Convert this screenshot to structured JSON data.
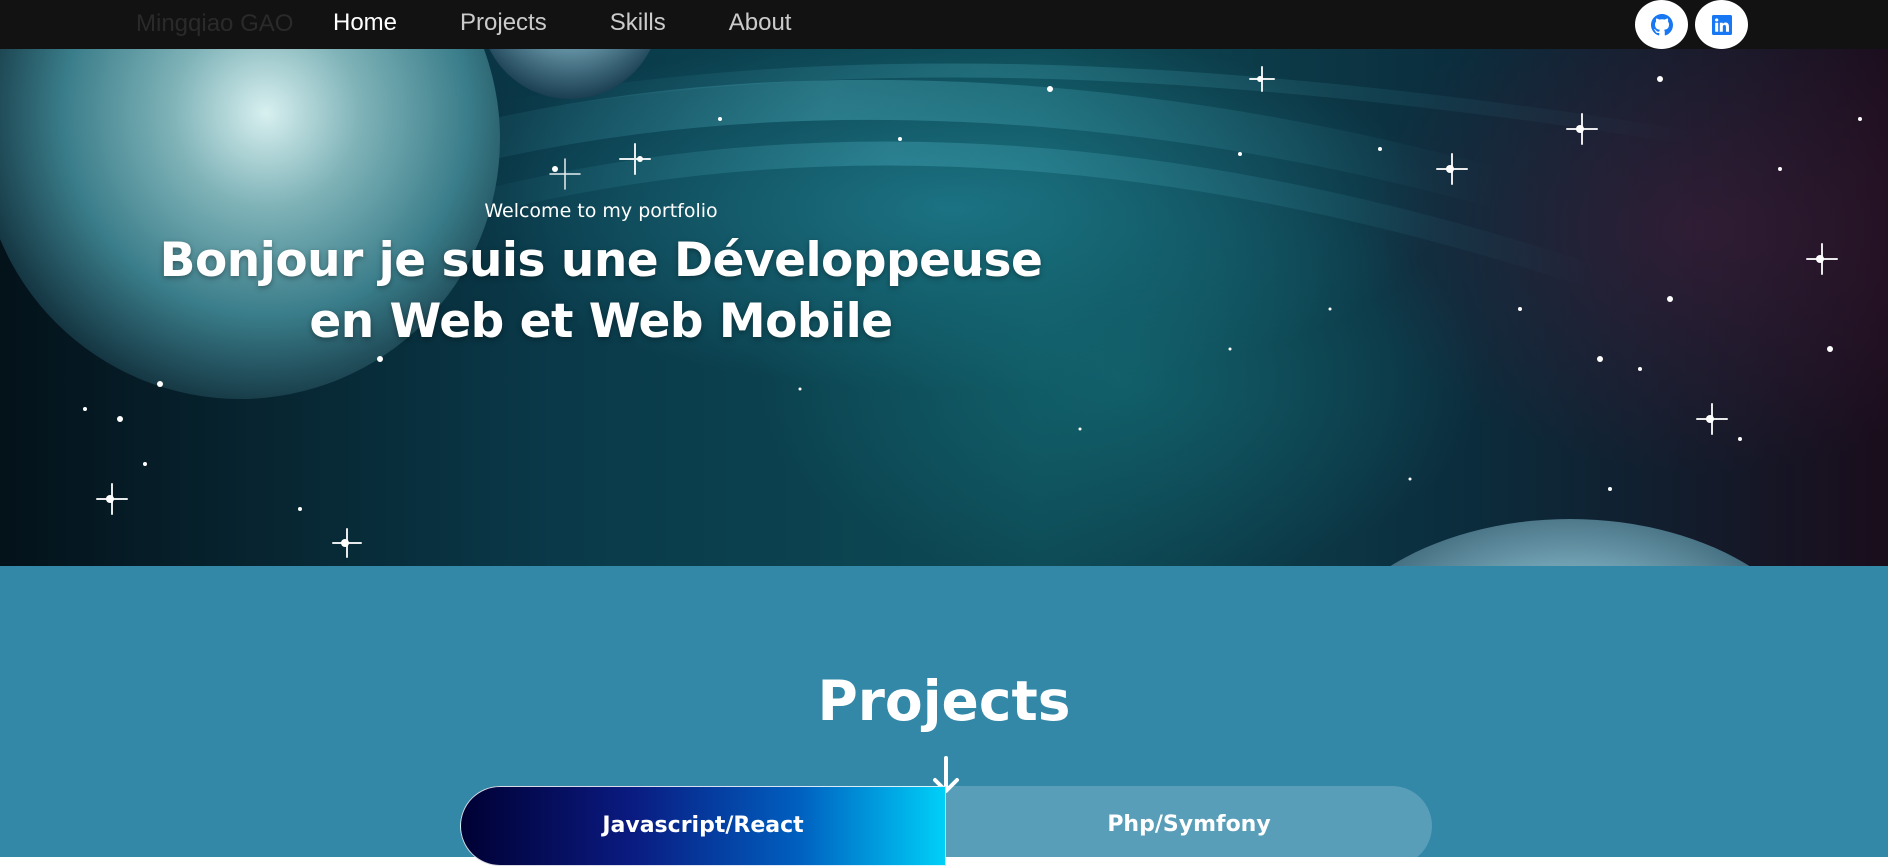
{
  "navbar": {
    "brand": "Mingqiao GAO",
    "links": [
      {
        "label": "Home",
        "active": true
      },
      {
        "label": "Projects",
        "active": false
      },
      {
        "label": "Skills",
        "active": false
      },
      {
        "label": "About",
        "active": false
      }
    ],
    "social": {
      "github_icon": "github-icon",
      "linkedin_icon": "linkedin-icon"
    }
  },
  "hero": {
    "welcome": "Welcome to my portfolio",
    "headline": "Bonjour je suis une Développeuse en Web et Web Mobile"
  },
  "projects": {
    "title": "Projects",
    "arrow_icon": "arrow-down-icon",
    "tabs": [
      {
        "label": "Javascript/React",
        "active": true
      },
      {
        "label": "Php/Symfony",
        "active": false
      }
    ]
  },
  "colors": {
    "navbar_bg": "#121212",
    "projects_bg": "#3388a8",
    "accent_icon": "#1877f2"
  }
}
